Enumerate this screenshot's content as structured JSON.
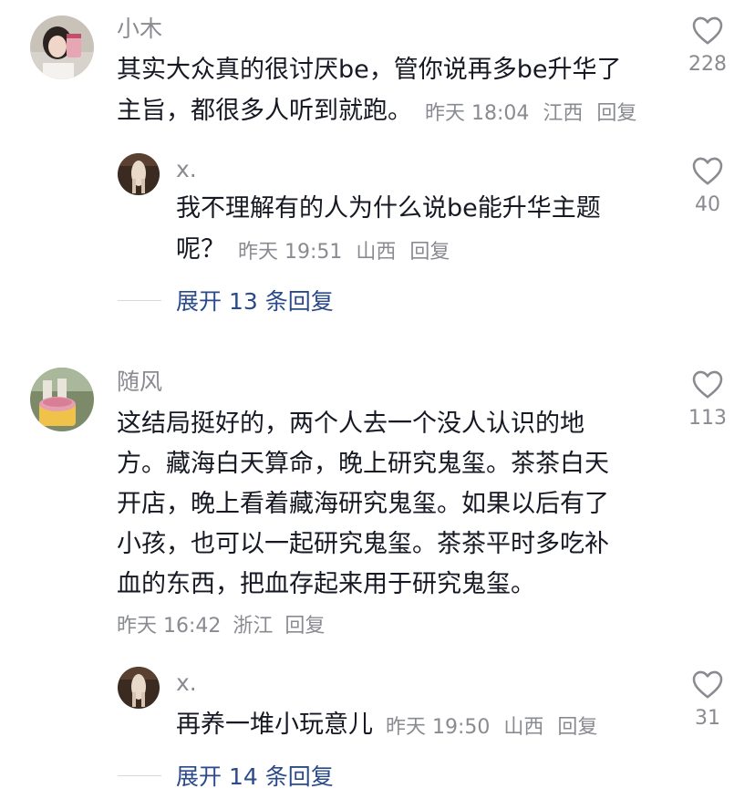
{
  "comments": [
    {
      "user": "小木",
      "text": "其实大众真的很讨厌be，管你说再多be升华了主旨，都很多人听到就跑。",
      "line1": "其实大众真的很讨厌be，管你说再多be升华了",
      "line2": "主旨，都很多人听到就跑。",
      "time": "昨天 18:04",
      "location": "江西",
      "reply_label": "回复",
      "likes": "228",
      "avatar_icon": "girl-with-cup-photo-avatar",
      "reply": {
        "user": "x.",
        "line1": "我不理解有的人为什么说be能升华主题",
        "line2": "呢？",
        "time": "昨天 19:51",
        "location": "山西",
        "reply_label": "回复",
        "likes": "40",
        "avatar_icon": "figure-photo-avatar"
      },
      "expand_label": "展开 13 条回复"
    },
    {
      "user": "随风",
      "lines": [
        "这结局挺好的，两个人去一个没人认识的地",
        "方。藏海白天算命，晚上研究鬼玺。茶茶白天",
        "开店，晚上看着藏海研究鬼玺。如果以后有了",
        "小孩，也可以一起研究鬼玺。茶茶平时多吃补",
        "血的东西，把血存起来用于研究鬼玺。"
      ],
      "time": "昨天 16:42",
      "location": "浙江",
      "reply_label": "回复",
      "likes": "113",
      "avatar_icon": "ice-cream-photo-avatar",
      "reply": {
        "user": "x.",
        "line1": "再养一堆小玩意儿",
        "time": "昨天 19:50",
        "location": "山西",
        "reply_label": "回复",
        "likes": "31",
        "avatar_icon": "figure-photo-avatar"
      },
      "expand_label": "展开 14 条回复"
    }
  ],
  "colors": {
    "text": "#161823",
    "secondary": "#8a8b91",
    "link": "#2b4a8a",
    "divider": "#d9d9dd"
  }
}
